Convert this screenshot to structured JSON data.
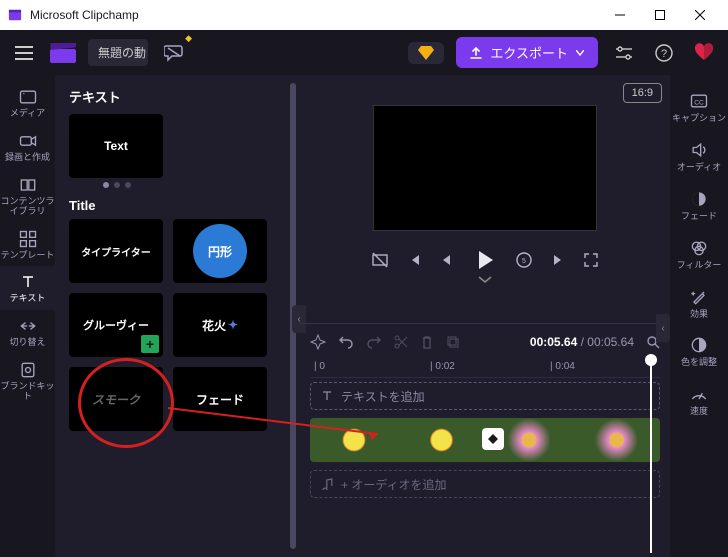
{
  "titlebar": {
    "app_name": "Microsoft Clipchamp"
  },
  "topbar": {
    "project_name": "無題の動",
    "export_label": "エクスポート"
  },
  "leftnav": {
    "media": "メディア",
    "record": "録画と作成",
    "library": "コンテンツライブラリ",
    "templates": "テンプレート",
    "text": "テキスト",
    "transitions": "切り替え",
    "brandkit": "ブランドキット"
  },
  "panel": {
    "section_text": "テキスト",
    "text_thumb": "Text",
    "section_title": "Title",
    "typewriter": "タイプライター",
    "circle": "円形",
    "groovy": "グルーヴィー",
    "fireworks": "花火",
    "smoke": "スモーク",
    "fade": "フェード"
  },
  "preview": {
    "aspect": "16:9"
  },
  "timeline": {
    "time_current": "00:05.64",
    "time_total": "00:05.64",
    "ruler_0": "| 0",
    "ruler_2": "| 0:02",
    "ruler_4": "| 0:04",
    "add_text": "テキストを追加",
    "add_audio": "+ オーディオを追加"
  },
  "rightnav": {
    "captions": "キャプション",
    "audio": "オーディオ",
    "fade": "フェード",
    "filters": "フィルター",
    "effects": "効果",
    "adjust": "色を調整",
    "speed": "速度"
  }
}
